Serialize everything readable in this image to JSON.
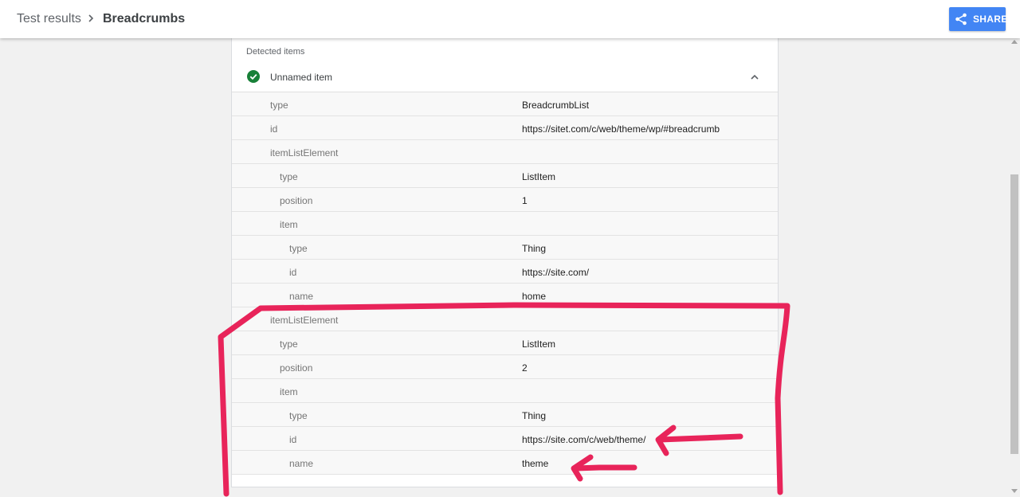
{
  "header": {
    "breadcrumb_root": "Test results",
    "breadcrumb_current": "Breadcrumbs",
    "share_label": "SHARE"
  },
  "panel": {
    "section_title": "Detected items",
    "item_title": "Unnamed item",
    "rows": [
      {
        "level": 0,
        "key": "type",
        "value": "BreadcrumbList"
      },
      {
        "level": 0,
        "key": "id",
        "value": "https://sitet.com/c/web/theme/wp/#breadcrumb"
      },
      {
        "level": 0,
        "key": "itemListElement",
        "value": ""
      },
      {
        "level": 1,
        "key": "type",
        "value": "ListItem"
      },
      {
        "level": 1,
        "key": "position",
        "value": "1"
      },
      {
        "level": 1,
        "key": "item",
        "value": ""
      },
      {
        "level": 2,
        "key": "type",
        "value": "Thing"
      },
      {
        "level": 2,
        "key": "id",
        "value": "https://site.com/"
      },
      {
        "level": 2,
        "key": "name",
        "value": "home"
      },
      {
        "level": 0,
        "key": "itemListElement",
        "value": ""
      },
      {
        "level": 1,
        "key": "type",
        "value": "ListItem"
      },
      {
        "level": 1,
        "key": "position",
        "value": "2"
      },
      {
        "level": 1,
        "key": "item",
        "value": ""
      },
      {
        "level": 2,
        "key": "type",
        "value": "Thing"
      },
      {
        "level": 2,
        "key": "id",
        "value": "https://site.com/c/web/theme/"
      },
      {
        "level": 2,
        "key": "name",
        "value": "theme"
      }
    ]
  },
  "icons": {
    "breadcrumb_separator": "chevron-right-icon",
    "share": "share-icon",
    "status": "check-circle-icon",
    "collapse": "chevron-up-icon"
  },
  "colors": {
    "share_button": "#4285f4",
    "check": "#188038",
    "annotation": "#e8245a"
  }
}
